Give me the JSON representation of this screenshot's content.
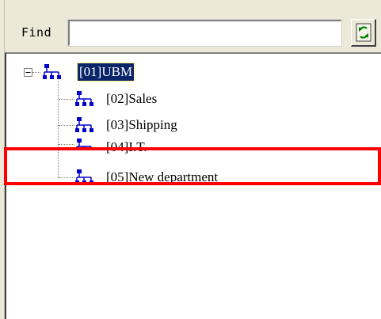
{
  "find_bar": {
    "label": "Find",
    "input_value": "",
    "refresh_icon": "refresh-icon"
  },
  "tree": {
    "root": {
      "label": "[01]UBM",
      "expander": "−",
      "selected": true,
      "icon": "org-chart-icon"
    },
    "children": [
      {
        "label": "[02]Sales",
        "icon": "org-chart-icon"
      },
      {
        "label": "[03]Shipping",
        "icon": "org-chart-icon"
      },
      {
        "label": "[04]I.T.",
        "icon": "org-chart-icon"
      },
      {
        "label": "[05]New department",
        "icon": "org-chart-icon"
      }
    ]
  },
  "colors": {
    "selection_bg": "#0a246a",
    "highlight_box": "#ff0000",
    "icon_blue": "#0000cc"
  }
}
